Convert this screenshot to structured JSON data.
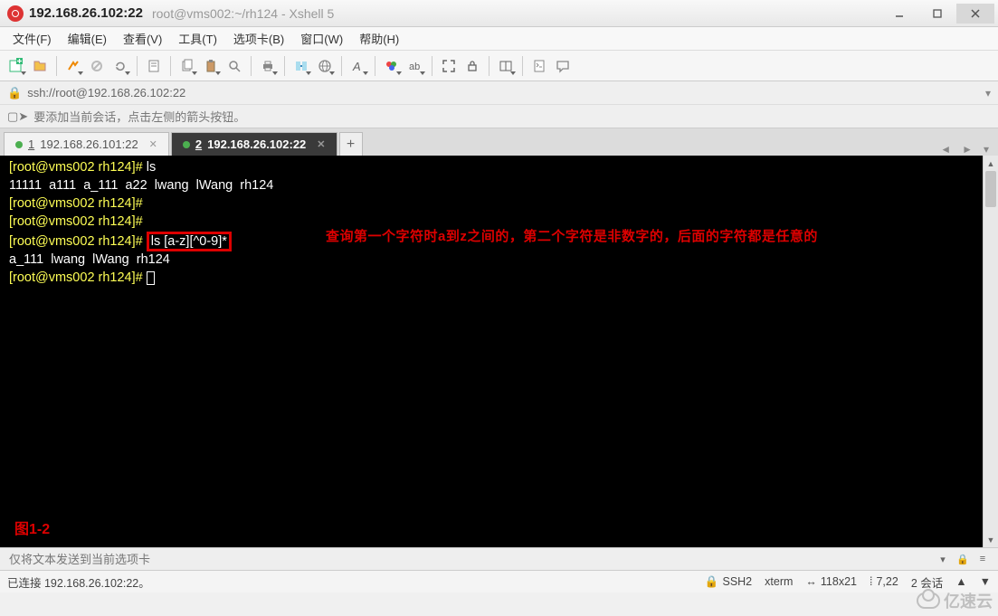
{
  "window": {
    "title_main": "192.168.26.102:22",
    "title_sub": "root@vms002:~/rh124 - Xshell 5"
  },
  "menu": {
    "file": "文件(F)",
    "edit": "编辑(E)",
    "view": "查看(V)",
    "tools": "工具(T)",
    "tabs": "选项卡(B)",
    "window": "窗口(W)",
    "help": "帮助(H)"
  },
  "address": {
    "prefix_icon": "lock",
    "url": "ssh://root@192.168.26.102:22"
  },
  "infobar": {
    "text": "要添加当前会话，点击左侧的箭头按钮。"
  },
  "tabs": {
    "items": [
      {
        "num": "1",
        "label": "192.168.26.101:22",
        "active": false
      },
      {
        "num": "2",
        "label": "192.168.26.102:22",
        "active": true
      }
    ]
  },
  "terminal": {
    "lines": [
      {
        "prompt": "[root@vms002 rh124]# ",
        "cmd": "ls"
      },
      {
        "plain": "11111  a111  a_111  a22  lwang  lWang  rh124"
      },
      {
        "prompt": "[root@vms002 rh124]# ",
        "cmd": ""
      },
      {
        "prompt": "[root@vms002 rh124]# ",
        "cmd": ""
      },
      {
        "prompt": "[root@vms002 rh124]# ",
        "cmd_hl": "ls [a-z][^0-9]*"
      },
      {
        "plain": "a_111  lwang  lWang  rh124"
      },
      {
        "prompt": "[root@vms002 rh124]# ",
        "cursor": true
      }
    ],
    "annotation": "查询第一个字符时a到z之间的，第二个字符是非数字的，后面的字符都是任意的",
    "fig_label": "图1-2"
  },
  "sendbar": {
    "placeholder": "仅将文本发送到当前选项卡"
  },
  "status": {
    "conn": "已连接 192.168.26.102:22。",
    "proto": "SSH2",
    "termtype": "xterm",
    "size": "118x21",
    "cursor": "7,22",
    "sessions": "2 会话"
  },
  "watermark": "亿速云"
}
